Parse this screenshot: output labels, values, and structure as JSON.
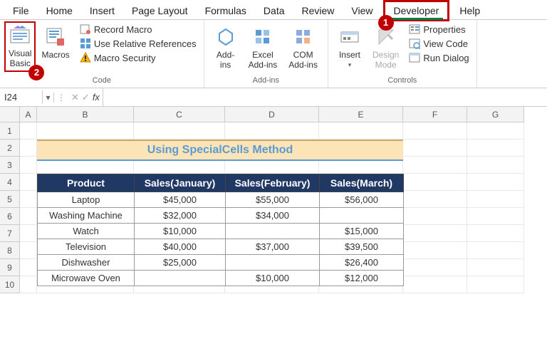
{
  "tabs": {
    "file": "File",
    "home": "Home",
    "insert": "Insert",
    "layout": "Page Layout",
    "formulas": "Formulas",
    "data": "Data",
    "review": "Review",
    "view": "View",
    "developer": "Developer",
    "help": "Help"
  },
  "badges": {
    "n1": "1",
    "n2": "2"
  },
  "ribbon": {
    "code": {
      "vb": "Visual\nBasic",
      "macros": "Macros",
      "record": "Record Macro",
      "relref": "Use Relative References",
      "security": "Macro Security",
      "label": "Code"
    },
    "addins": {
      "addins": "Add-\nins",
      "excel": "Excel\nAdd-ins",
      "com": "COM\nAdd-ins",
      "label": "Add-ins"
    },
    "controls": {
      "insert": "Insert",
      "design": "Design\nMode",
      "props": "Properties",
      "viewcode": "View Code",
      "rundlg": "Run Dialog",
      "label": "Controls"
    }
  },
  "fbar": {
    "name": "I24",
    "fx": "fx"
  },
  "cols": {
    "A": "A",
    "B": "B",
    "C": "C",
    "D": "D",
    "E": "E",
    "F": "F",
    "G": "G"
  },
  "rowlabels": [
    "1",
    "2",
    "3",
    "4",
    "5",
    "6",
    "7",
    "8",
    "9",
    "10"
  ],
  "title": "Using SpecialCells Method",
  "headers": {
    "p": "Product",
    "jan": "Sales(January)",
    "feb": "Sales(February)",
    "mar": "Sales(March)"
  },
  "chart_data": {
    "type": "table",
    "columns": [
      "Product",
      "Sales(January)",
      "Sales(February)",
      "Sales(March)"
    ],
    "rows": [
      {
        "product": "Laptop",
        "jan": "$45,000",
        "feb": "$55,000",
        "mar": "$56,000"
      },
      {
        "product": "Washing Machine",
        "jan": "$32,000",
        "feb": "$34,000",
        "mar": ""
      },
      {
        "product": "Watch",
        "jan": "$10,000",
        "feb": "",
        "mar": "$15,000"
      },
      {
        "product": "Television",
        "jan": "$40,000",
        "feb": "$37,000",
        "mar": "$39,500"
      },
      {
        "product": "Dishwasher",
        "jan": "$25,000",
        "feb": "",
        "mar": "$26,400"
      },
      {
        "product": "Microwave Oven",
        "jan": "",
        "feb": "$10,000",
        "mar": "$12,000"
      }
    ]
  }
}
